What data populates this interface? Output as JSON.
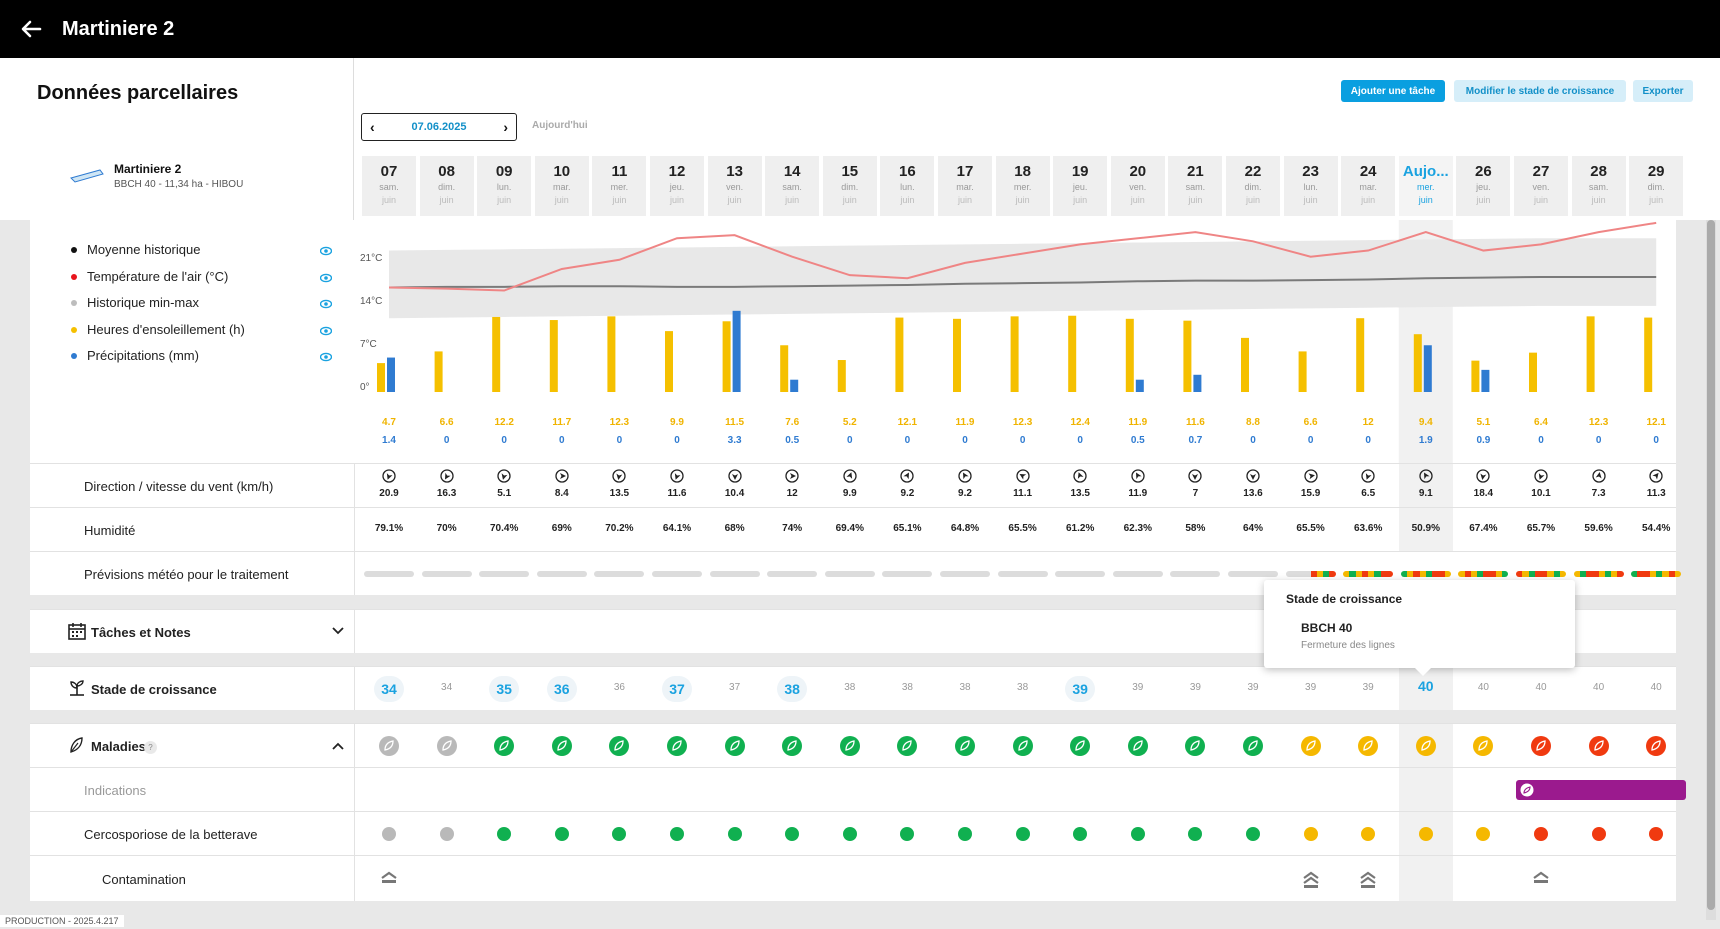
{
  "app": {
    "title": "Martiniere 2",
    "back_icon": "arrow-left-icon"
  },
  "header": {
    "section_title": "Données parcellaires",
    "parcel_name": "Martiniere 2",
    "parcel_info": "BBCH 40 - 11,34 ha - HIBOU",
    "buttons": {
      "add_task": "Ajouter une tâche",
      "modify_stage": "Modifier le stade de croissance",
      "export": "Exporter"
    },
    "date": "07.06.2025",
    "today_link": "Aujourd'hui"
  },
  "days": [
    {
      "n": "07",
      "w": "sam.",
      "m": "juin"
    },
    {
      "n": "08",
      "w": "dim.",
      "m": "juin"
    },
    {
      "n": "09",
      "w": "lun.",
      "m": "juin"
    },
    {
      "n": "10",
      "w": "mar.",
      "m": "juin"
    },
    {
      "n": "11",
      "w": "mer.",
      "m": "juin"
    },
    {
      "n": "12",
      "w": "jeu.",
      "m": "juin"
    },
    {
      "n": "13",
      "w": "ven.",
      "m": "juin"
    },
    {
      "n": "14",
      "w": "sam.",
      "m": "juin"
    },
    {
      "n": "15",
      "w": "dim.",
      "m": "juin"
    },
    {
      "n": "16",
      "w": "lun.",
      "m": "juin"
    },
    {
      "n": "17",
      "w": "mar.",
      "m": "juin"
    },
    {
      "n": "18",
      "w": "mer.",
      "m": "juin"
    },
    {
      "n": "19",
      "w": "jeu.",
      "m": "juin"
    },
    {
      "n": "20",
      "w": "ven.",
      "m": "juin"
    },
    {
      "n": "21",
      "w": "sam.",
      "m": "juin"
    },
    {
      "n": "22",
      "w": "dim.",
      "m": "juin"
    },
    {
      "n": "23",
      "w": "lun.",
      "m": "juin"
    },
    {
      "n": "24",
      "w": "mar.",
      "m": "juin"
    },
    {
      "n": "Aujo...",
      "w": "mer.",
      "m": "juin",
      "today": true
    },
    {
      "n": "26",
      "w": "jeu.",
      "m": "juin"
    },
    {
      "n": "27",
      "w": "ven.",
      "m": "juin"
    },
    {
      "n": "28",
      "w": "sam.",
      "m": "juin"
    },
    {
      "n": "29",
      "w": "dim.",
      "m": "juin"
    }
  ],
  "legend": [
    {
      "label": "Moyenne historique",
      "color": "#111111"
    },
    {
      "label": "Température de l'air (°C)",
      "color": "#e8141c"
    },
    {
      "label": "Historique min-max",
      "color": "#bdbdbd"
    },
    {
      "label": "Heures d'ensoleillement (h)",
      "color": "#f5c000"
    },
    {
      "label": "Précipitations (mm)",
      "color": "#2f7bd1"
    }
  ],
  "chart_data": {
    "type": "bar",
    "y_ticks": [
      "0°",
      "7°C",
      "14°C",
      "21°C"
    ],
    "ylim": [
      0,
      28
    ],
    "sunshine": [
      4.7,
      6.6,
      12.2,
      11.7,
      12.3,
      9.9,
      11.5,
      7.6,
      5.2,
      12.1,
      11.9,
      12.3,
      12.4,
      11.9,
      11.6,
      8.8,
      6.6,
      12,
      9.4,
      5.1,
      6.4,
      12.3,
      12.1
    ],
    "precip": [
      1.4,
      0,
      0,
      0,
      0,
      0,
      3.3,
      0.5,
      0,
      0,
      0,
      0,
      0,
      0.5,
      0.7,
      0,
      0,
      0,
      1.9,
      0.9,
      0,
      0,
      0
    ],
    "sunshine_labels": [
      "4.7",
      "6.6",
      "12.2",
      "11.7",
      "12.3",
      "9.9",
      "11.5",
      "7.6",
      "5.2",
      "12.1",
      "11.9",
      "12.3",
      "12.4",
      "11.9",
      "11.6",
      "8.8",
      "6.6",
      "12",
      "9.4",
      "5.1",
      "6.4",
      "12.3",
      "12.1"
    ],
    "precip_labels": [
      "1.4",
      "0",
      "0",
      "0",
      "0",
      "0",
      "3.3",
      "0.5",
      "0",
      "0",
      "0",
      "0",
      "0",
      "0.5",
      "0.7",
      "0",
      "0",
      "0",
      "1.9",
      "0.9",
      "0",
      "0",
      "0"
    ],
    "air_temp": [
      17,
      16.8,
      16.5,
      20,
      21.5,
      25,
      25.5,
      22,
      19,
      18.5,
      21,
      22.5,
      24,
      25,
      26,
      24.5,
      22,
      23,
      26,
      23,
      24,
      26,
      27.5
    ],
    "hist_avg": [
      17,
      17.1,
      17.1,
      17.2,
      17.2,
      17.1,
      17.1,
      17.2,
      17.3,
      17.4,
      17.6,
      17.7,
      17.8,
      18,
      18.1,
      18.1,
      18.2,
      18.3,
      18.5,
      18.6,
      18.7,
      18.7,
      18.7
    ],
    "hist_min": [
      12,
      12.1,
      12.2,
      12.3,
      12.4,
      12.5,
      12.6,
      12.7,
      12.8,
      12.9,
      13,
      13.1,
      13.2,
      13.3,
      13.4,
      13.5,
      13.6,
      13.7,
      13.8,
      13.9,
      14,
      14,
      14
    ],
    "hist_max": [
      23,
      23.1,
      23.2,
      23.3,
      23.4,
      23.5,
      23.6,
      23.7,
      23.8,
      23.9,
      24,
      24.1,
      24.2,
      24.3,
      24.4,
      24.5,
      24.6,
      24.7,
      24.8,
      24.9,
      25,
      25,
      25
    ],
    "colors": {
      "sunshine": "#f5c000",
      "precip": "#2f7bd1",
      "air_temp": "#ef8585",
      "hist_avg": "#7a7a7a",
      "hist_band": "#e8e8e8"
    }
  },
  "rows": {
    "wind": {
      "label": "Direction / vitesse du vent (km/h)",
      "values": [
        "20.9",
        "16.3",
        "5.1",
        "8.4",
        "13.5",
        "11.6",
        "10.4",
        "12",
        "9.9",
        "9.2",
        "9.2",
        "11.1",
        "13.5",
        "11.9",
        "7",
        "13.6",
        "15.9",
        "6.5",
        "9.1",
        "18.4",
        "10.1",
        "7.3",
        "11.3"
      ],
      "angles": [
        200,
        210,
        195,
        90,
        190,
        200,
        180,
        90,
        20,
        30,
        330,
        300,
        340,
        330,
        180,
        180,
        80,
        200,
        330,
        190,
        200,
        10,
        40
      ]
    },
    "humidity": {
      "label": "Humidité",
      "values": [
        "79.1%",
        "70%",
        "70.4%",
        "69%",
        "70.2%",
        "64.1%",
        "68%",
        "74%",
        "69.4%",
        "65.1%",
        "64.8%",
        "65.5%",
        "61.2%",
        "62.3%",
        "58%",
        "64%",
        "65.5%",
        "63.6%",
        "50.9%",
        "67.4%",
        "65.7%",
        "59.6%",
        "54.4%"
      ]
    },
    "treatment": {
      "label": "Prévisions météo pour le traitement"
    },
    "tasks": {
      "label": "Tâches et Notes",
      "icon": "calendar-icon",
      "chevron": "chevron-down-icon"
    },
    "growth": {
      "label": "Stade de croissance",
      "icon": "sprout-icon",
      "values": [
        "34",
        "34",
        "35",
        "36",
        "36",
        "37",
        "37",
        "38",
        "38",
        "38",
        "38",
        "38",
        "39",
        "39",
        "39",
        "39",
        "39",
        "39",
        "40",
        "40",
        "40",
        "40",
        "40"
      ],
      "highlight": [
        true,
        false,
        true,
        true,
        false,
        true,
        false,
        true,
        false,
        false,
        false,
        false,
        true,
        false,
        false,
        false,
        false,
        false,
        true,
        false,
        false,
        false,
        false
      ]
    },
    "diseases": {
      "label": "Maladies",
      "help": "?",
      "icon": "leaf-icon",
      "chevron": "chevron-up-icon",
      "levels": [
        "grey",
        "grey",
        "green",
        "green",
        "green",
        "green",
        "green",
        "green",
        "green",
        "green",
        "green",
        "green",
        "green",
        "green",
        "green",
        "green",
        "yellow",
        "yellow",
        "yellow",
        "yellow",
        "red",
        "red",
        "red"
      ]
    },
    "indications": {
      "label": "Indications"
    },
    "cercospora": {
      "label": "Cercosporiose de la betterave",
      "levels": [
        "grey",
        "grey",
        "green",
        "green",
        "green",
        "green",
        "green",
        "green",
        "green",
        "green",
        "green",
        "green",
        "green",
        "green",
        "green",
        "green",
        "yellow",
        "yellow",
        "yellow",
        "yellow",
        "red",
        "red",
        "red"
      ]
    },
    "contamination": {
      "label": "Contamination"
    }
  },
  "tooltip": {
    "title": "Stade de croissance",
    "code": "BBCH 40",
    "description": "Fermeture des lignes"
  },
  "footer": "PRODUCTION - 2025.4.217",
  "colors": {
    "accent": "#0a9fe0",
    "green": "#10b050",
    "yellow": "#f5b800",
    "red": "#f03a10",
    "grey": "#b9b9b9",
    "purple": "#9b1a8e"
  }
}
